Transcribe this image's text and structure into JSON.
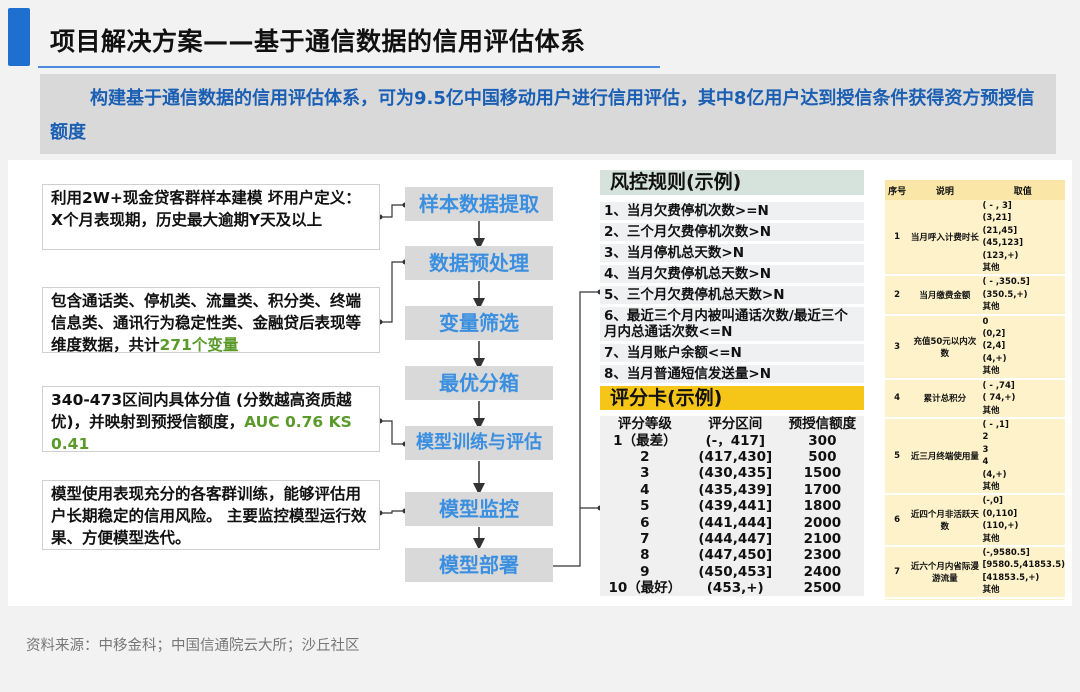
{
  "title": "项目解决方案——基于通信数据的信用评估体系",
  "banner": "构建基于通信数据的信用评估体系，可为9.5亿中国移动用户进行信用评估，其中8亿用户达到授信条件获得资方预授信额度",
  "descriptions": {
    "d1": "利用2W+现金贷客群样本建模 坏用户定义：X个月表现期，历史最大逾期Y天及以上",
    "d2_text": "包含通话类、停机类、流量类、积分类、终端信息类、通讯行为稳定性类、金融贷后表现等维度数据，共计",
    "d2_hl": "271个变量",
    "d3_text": "340-473区间内具体分值 (分数越高资质越优)，并映射到预授信额度，",
    "d3_hl": "AUC 0.76 KS 0.41",
    "d4": "模型使用表现充分的各客群训练，能够评估用户长期稳定的信用风险。 主要监控模型运行效果、方便模型迭代。"
  },
  "steps": [
    "样本数据提取",
    "数据预处理",
    "变量筛选",
    "最优分箱",
    "模型训练与评估",
    "模型监控",
    "模型部署"
  ],
  "rules": {
    "heading": "风控规则(示例)",
    "items": [
      "1、当月欠费停机次数>=N",
      "2、三个月欠费停机次数>N",
      "3、当月停机总天数>N",
      "4、当月欠费停机总天数>N",
      "5、三个月欠费停机总天数>N",
      "6、最近三个月内被叫通话次数/最近三个月内总通话次数<=N",
      "7、当月账户余额<=N",
      "8、当月普通短信发送量>N"
    ]
  },
  "scorecard": {
    "heading": "评分卡(示例)",
    "columns": [
      "评分等级",
      "评分区间",
      "预授信额度"
    ],
    "rows": [
      [
        "1（最差）",
        "(-，417]",
        "300"
      ],
      [
        "2",
        "(417,430]",
        "500"
      ],
      [
        "3",
        "(430,435]",
        "1500"
      ],
      [
        "4",
        "(435,439]",
        "1700"
      ],
      [
        "5",
        "(439,441]",
        "1800"
      ],
      [
        "6",
        "(441,444]",
        "2000"
      ],
      [
        "7",
        "(444,447]",
        "2100"
      ],
      [
        "8",
        "(447,450]",
        "2300"
      ],
      [
        "9",
        "(450,453]",
        "2400"
      ],
      [
        "10（最好）",
        "(453,+)",
        "2500"
      ]
    ]
  },
  "variables": {
    "columns": [
      "序号",
      "说明",
      "取值"
    ],
    "rows": [
      {
        "no": "1",
        "desc": "当月呼入计费时长",
        "vals": [
          "( - , 3]",
          "(3,21]",
          "(21,45]",
          "(45,123]",
          "(123,+)",
          "其他"
        ]
      },
      {
        "no": "2",
        "desc": "当月缴费金额",
        "vals": [
          "( - ,350.5]",
          "(350.5,+)",
          "其他"
        ]
      },
      {
        "no": "3",
        "desc": "充值50元以内次数",
        "vals": [
          "0",
          "(0,2]",
          "(2,4]",
          "(4,+)",
          "其他"
        ]
      },
      {
        "no": "4",
        "desc": "累计总积分",
        "vals": [
          "( - ,74]",
          "( 74,+)",
          "其他"
        ]
      },
      {
        "no": "5",
        "desc": "近三月终端使用量",
        "vals": [
          "( - ,1]",
          "2",
          "3",
          "4",
          "(4,+)",
          "其他"
        ]
      },
      {
        "no": "6",
        "desc": "近四个月非活跃天数",
        "vals": [
          "(-,0]",
          "(0,110]",
          "(110,+)",
          "其他"
        ]
      },
      {
        "no": "7",
        "desc": "近六个月内省际漫游流量",
        "vals": [
          "(-,9580.5]",
          "[9580.5,41853.5)",
          "[41853.5,+)",
          "其他"
        ]
      }
    ]
  },
  "source": "资料来源：中移金科；中国信通院云大所；沙丘社区",
  "colors": {
    "accent": "#1f6fd1",
    "banner_text": "#1a5fb4",
    "step_text": "#3b8fe0",
    "highlight": "#5a9a2a",
    "scorecard_head": "#f5c518",
    "rules_head": "#d6e3dc",
    "sidepanel": "#fdf2c9"
  }
}
